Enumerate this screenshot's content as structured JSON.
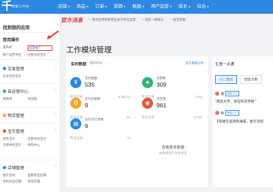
{
  "brand": {
    "glyph": "千",
    "subtitle": "商家工作台"
  },
  "nav": [
    {
      "label": "店铺"
    },
    {
      "label": "商品"
    },
    {
      "label": "订单"
    },
    {
      "label": "营销"
    },
    {
      "label": "数据"
    },
    {
      "label": "用户运营"
    },
    {
      "label": "成长"
    },
    {
      "label": "综合"
    }
  ],
  "sidebar": {
    "find_app": "找到我的应用",
    "common_ops": {
      "title": "常用操作",
      "links": [
        "发布商",
        "批量推广",
        "客户运营平台",
        "出售中的宝贝"
      ]
    },
    "sections": [
      {
        "title": "交易管理",
        "links": [
          "已卖出的宝贝"
        ],
        "color": "#3a8ee6"
      },
      {
        "title": "自运营中心",
        "links": [
          "发微海",
          "淘宝群"
        ],
        "color": "#2bb673"
      },
      {
        "title": "物流管理",
        "links": [],
        "color": "#f5a623"
      },
      {
        "title": "宝贝管理",
        "links": [
          "发布宝贝",
          "出售中的宝贝",
          "仓库中的宝贝",
          "体检中心"
        ],
        "color": "#e6553a"
      },
      {
        "title": "店铺管理",
        "links": [
          "图片空间",
          "查看淘宝店铺",
          "手机淘宝店铺",
          "淘宝店铺"
        ],
        "color": "#3a8ee6"
      }
    ]
  },
  "notice": {
    "title": "官方消息",
    "items": [
      "香淘宝特新新营业关于供应运营",
      "淘宝一周快讯",
      "淘宝店铺"
    ]
  },
  "page_title": "工作模块管理",
  "realtime": {
    "title": "实时数据",
    "updated": "更新时间: -",
    "link": "官方数据分析",
    "metrics": [
      {
        "icon": "¥",
        "color": "#2c88e3",
        "label": "支付金额",
        "value": "535",
        "foot_label": "昨日全天",
        "foot_value": "5,363.13"
      },
      {
        "icon": "♣",
        "color": "#2bb673",
        "label": "访客数",
        "value": "309",
        "foot_label": "昨日全天",
        "foot_value": "1,615"
      },
      {
        "icon": "✪",
        "color": "#f5a623",
        "label": "支付买家数",
        "value": "9",
        "foot_label": "昨日全天",
        "foot_value": "69"
      },
      {
        "icon": "◉",
        "color": "#e6553a",
        "label": "浏览量",
        "value": "961",
        "foot_label": "昨日全天",
        "foot_value": "3,765"
      },
      {
        "icon": "▤",
        "color": "#2c88e3",
        "label": "支付子订单数",
        "value": "9",
        "foot_label": "昨日全天",
        "foot_value": "70"
      }
    ],
    "empty": {
      "title": "查看更多数据",
      "subtitle": "数据来源于生意参谋"
    }
  },
  "right_panel": {
    "title": "生意一点通",
    "tabs": [
      "小二建议",
      "智能诊断"
    ],
    "rows": [
      {
        "name": "淑",
        "badge": "淘宝小二"
      },
      {
        "name": "秋",
        "badge": "淘宝小二"
      }
    ],
    "texts": [
      "\"淘宝大学，淘宝快活学院 \"",
      "【快速生成挂钩海报，官方活动"
    ]
  }
}
